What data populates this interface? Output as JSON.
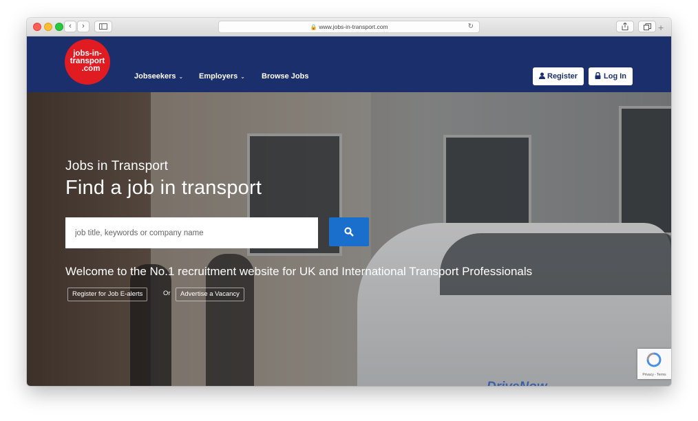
{
  "browser": {
    "url": "www.jobs-in-transport.com",
    "back_glyph": "‹",
    "forward_glyph": "›",
    "reload_glyph": "↻",
    "new_tab_glyph": "+"
  },
  "logo": {
    "line1": "jobs-in-",
    "line2": "transport",
    "line3": ".com"
  },
  "nav": {
    "jobseekers": "Jobseekers",
    "employers": "Employers",
    "browse_jobs": "Browse Jobs",
    "register": "Register",
    "login": "Log In",
    "chevron": "⌄"
  },
  "hero": {
    "subtitle": "Jobs in Transport",
    "title": "Find a job in transport",
    "search_placeholder": "job title, keywords or company name",
    "welcome": "Welcome to the No.1 recruitment website for UK and International Transport Professionals",
    "register_alerts": "Register for Job E-alerts",
    "or": "Or",
    "advertise": "Advertise a Vacancy",
    "car_brand": "DriveNow"
  },
  "recaptcha": {
    "label": "Privacy - Terms"
  },
  "colors": {
    "nav_bg": "#1c2f6d",
    "logo_red": "#e11b22",
    "search_button": "#1a6fcd"
  }
}
